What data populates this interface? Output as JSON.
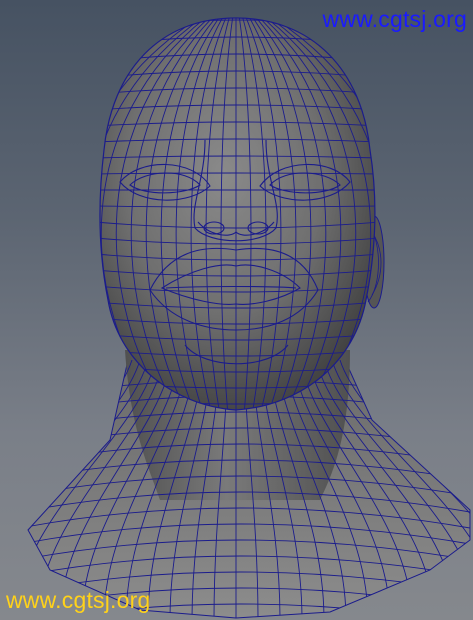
{
  "viewport": {
    "background_top": "#465262",
    "background_bottom": "#85888d",
    "mesh_fill": "#6f6f6f",
    "wire_color": "#1b1c8c"
  },
  "model": {
    "name": "head",
    "display": "wireframe-on-shaded"
  },
  "watermarks": {
    "top": "www.cgtsj.org",
    "top_color": "#1a1aff",
    "bottom": "www.cgtsj.org",
    "bottom_color": "#ffd21a"
  }
}
